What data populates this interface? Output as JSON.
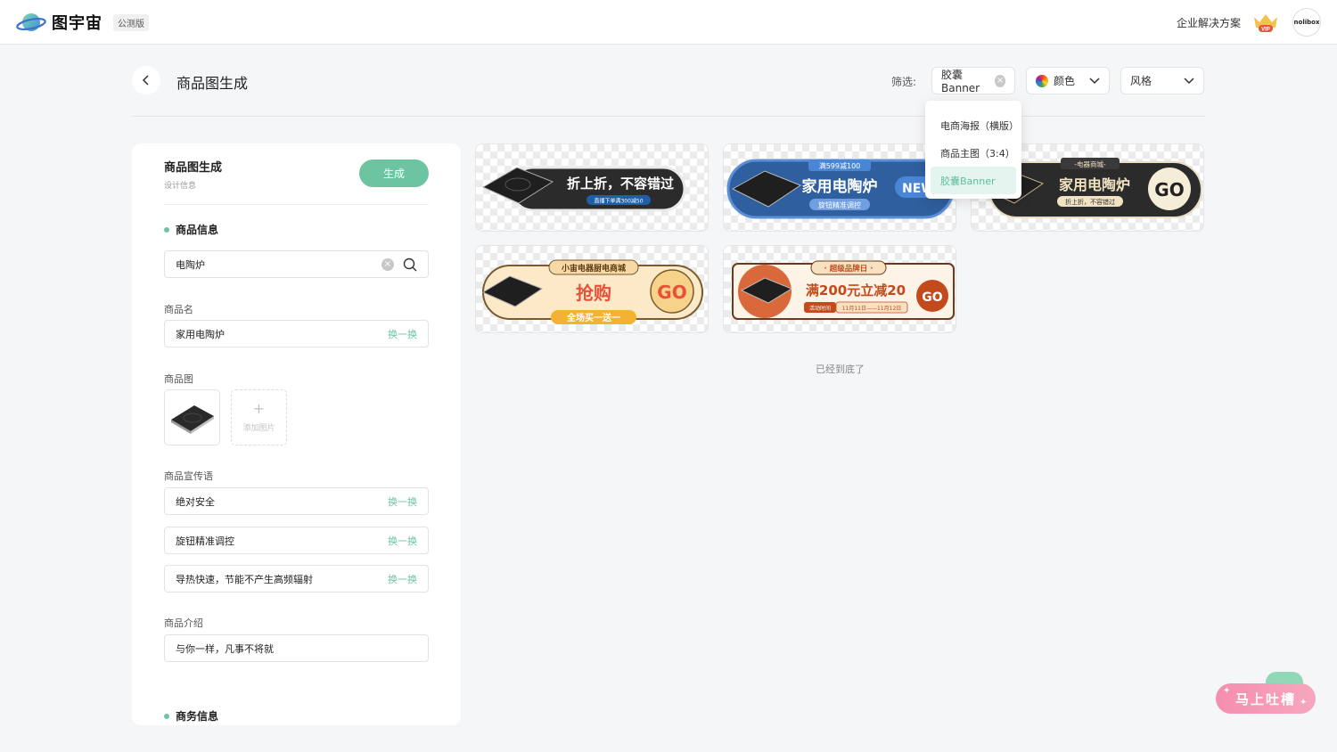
{
  "app": {
    "logo_text": "图宇宙",
    "beta_tag": "公测版",
    "enterprise_link": "企业解决方案",
    "vip_label": "VIP",
    "avatar_text": "nolibox"
  },
  "header": {
    "title": "商品图生成",
    "filter_label": "筛选:",
    "filters": {
      "type_value": "胶囊Banner",
      "color_label": "颜色",
      "style_label": "风格"
    },
    "dropdown_options": [
      {
        "label": "电商海报（横版）",
        "selected": false
      },
      {
        "label": "商品主图（3:4）",
        "selected": false
      },
      {
        "label": "胶囊Banner",
        "selected": true
      }
    ]
  },
  "panel": {
    "title": "商品图生成",
    "subtitle": "设计信息",
    "generate_label": "生成",
    "product_section": "商品信息",
    "search_value": "电陶炉",
    "name_label": "商品名",
    "name_value": "家用电陶炉",
    "swap_label": "换一换",
    "image_label": "商品图",
    "add_image_label": "添加图片",
    "slogan_label": "商品宣传语",
    "slogans": [
      "绝对安全",
      "旋钮精准调控",
      "导热快速，节能不产生高频辐射"
    ],
    "intro_label": "商品介绍",
    "intro_value": "与你一样，凡事不将就",
    "business_section": "商务信息"
  },
  "results": {
    "cards": [
      {
        "headline": "折上折，不容错过",
        "tag": "直播下单满300减50"
      },
      {
        "badge": "满599减100",
        "headline": "家用电陶炉",
        "sub": "旋钮精准调控",
        "corner": "NEW"
      },
      {
        "top": "-电器商城-",
        "headline": "家用电陶炉",
        "sub": "折上折，不容错过",
        "cta": "GO"
      },
      {
        "top": "小宙电器厨电商城",
        "headline": "抢购",
        "sub": "全场买一送一",
        "cta": "GO"
      },
      {
        "top": "· 超级品牌日 ·",
        "headline": "满200元立减20",
        "date_tag": "活动时间",
        "date_range": "11月11日——11月12日",
        "cta": "GO"
      }
    ],
    "end_text": "已经到底了"
  },
  "feedback": {
    "label": "马上吐槽"
  },
  "colors": {
    "accent": "#6cc4a1",
    "feedback": "#f58eaf",
    "selected_bg": "#e3f5ee"
  }
}
